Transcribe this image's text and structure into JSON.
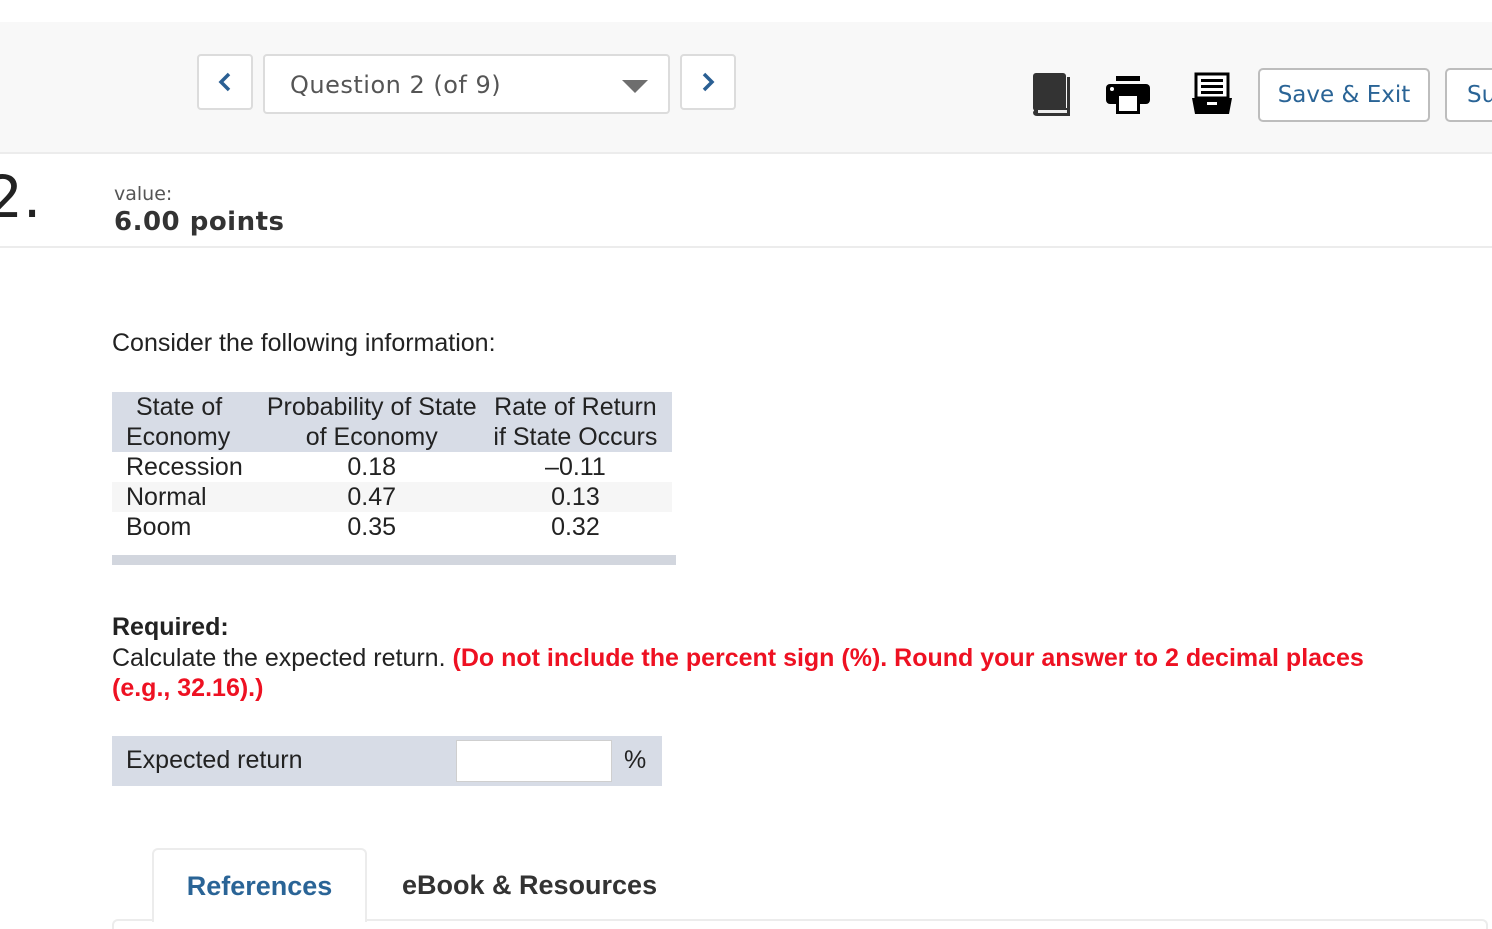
{
  "header": {
    "prev_label": "previous-question",
    "question_selector": "Question 2 (of 9)",
    "next_label": "next-question",
    "icons": [
      "book-icon",
      "printer-icon",
      "card-file-icon"
    ],
    "save_exit": "Save & Exit",
    "submit_partial": "Su"
  },
  "question": {
    "number": "2.",
    "value_label": "value:",
    "points": "6.00 points",
    "intro": "Consider the following information:",
    "table": {
      "headers": [
        [
          "State of",
          "Economy"
        ],
        [
          "Probability of State",
          "of Economy"
        ],
        [
          "Rate of Return",
          "if State Occurs"
        ]
      ],
      "rows": [
        [
          "Recession",
          "0.18",
          "–0.11"
        ],
        [
          "Normal",
          "0.47",
          "0.13"
        ],
        [
          "Boom",
          "0.35",
          "0.32"
        ]
      ]
    },
    "required_head": "Required:",
    "required_text": "Calculate the expected return.",
    "required_warning": "(Do not include the percent sign (%). Round your answer to 2 decimal places (e.g., 32.16).)",
    "answer": {
      "label": "Expected return",
      "value": "",
      "placeholder": "",
      "unit": "%"
    }
  },
  "tabs": [
    {
      "label": "References",
      "active": true
    },
    {
      "label": "eBook & Resources",
      "active": false
    }
  ],
  "colors": {
    "accent": "#2a6496",
    "warning": "#ee1122",
    "table_header_bg": "#d7dce6"
  }
}
